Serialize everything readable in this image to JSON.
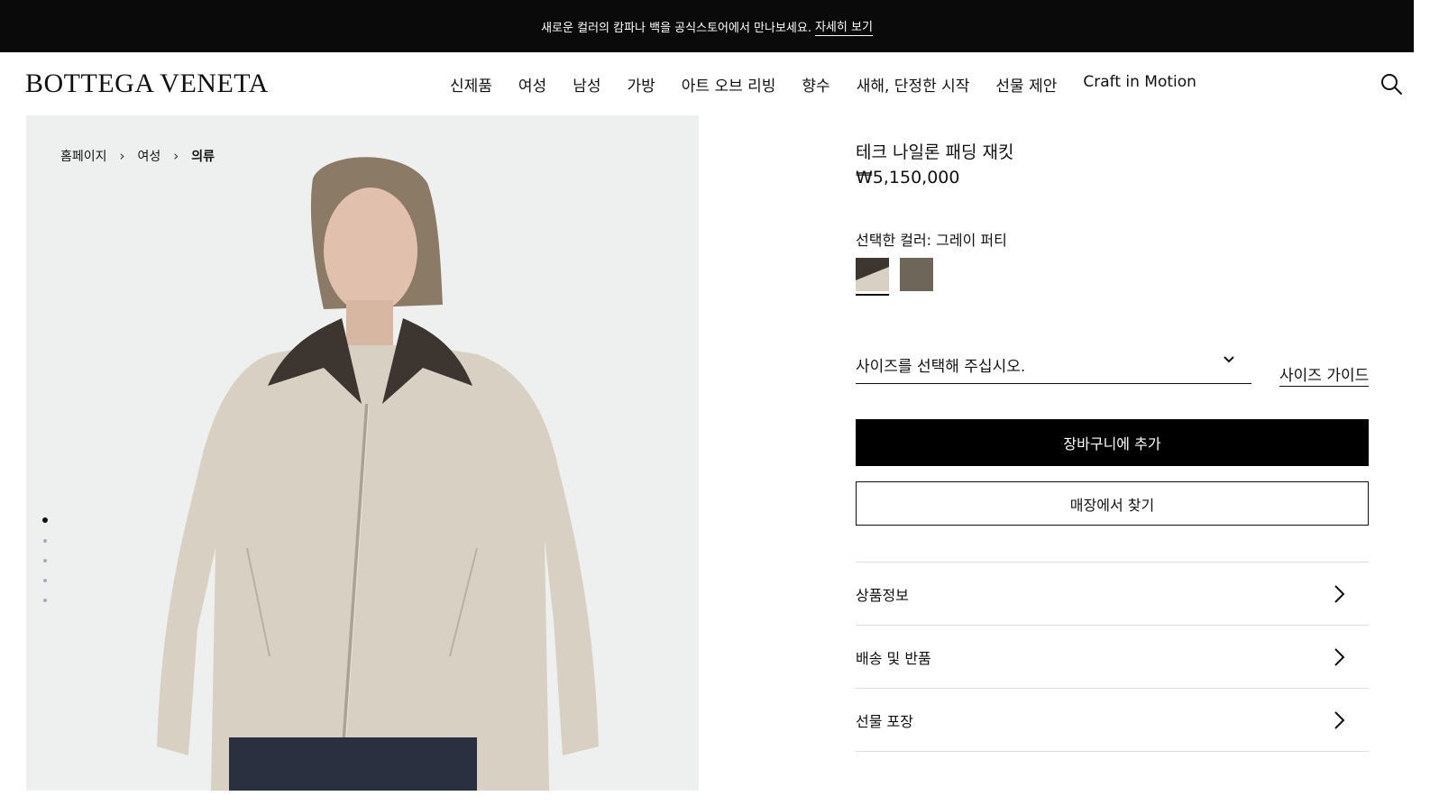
{
  "promo": {
    "text": "새로운 컬러의 캄파나 백을 공식스토어에서 만나보세요.",
    "link": "자세히 보기"
  },
  "header": {
    "logo": "BOTTEGA VENETA",
    "nav": [
      "신제품",
      "여성",
      "남성",
      "가방",
      "아트 오브 리빙",
      "향수",
      "새해, 단정한 시작",
      "선물 제안",
      "Craft in Motion"
    ],
    "search_icon": "search-icon"
  },
  "breadcrumb": {
    "home": "홈페이지",
    "section": "여성",
    "current": "의류"
  },
  "gallery": {
    "slides": 5,
    "active_slide": 1
  },
  "product": {
    "title": "테크 나일론 패딩 재킷",
    "price": "₩5,150,000",
    "color_label": "선택한 컬러: 그레이 퍼티",
    "swatch_colors": [
      "#d8d0c3",
      "#6e6658"
    ],
    "size_placeholder": "사이즈를 선택해 주십시오.",
    "size_guide": "사이즈 가이드",
    "add_to_cart": "장바구니에 추가",
    "find_in_store": "매장에서 찾기"
  },
  "accordion": [
    {
      "label": "상품정보"
    },
    {
      "label": "배송 및 반품"
    },
    {
      "label": "선물 포장"
    }
  ]
}
